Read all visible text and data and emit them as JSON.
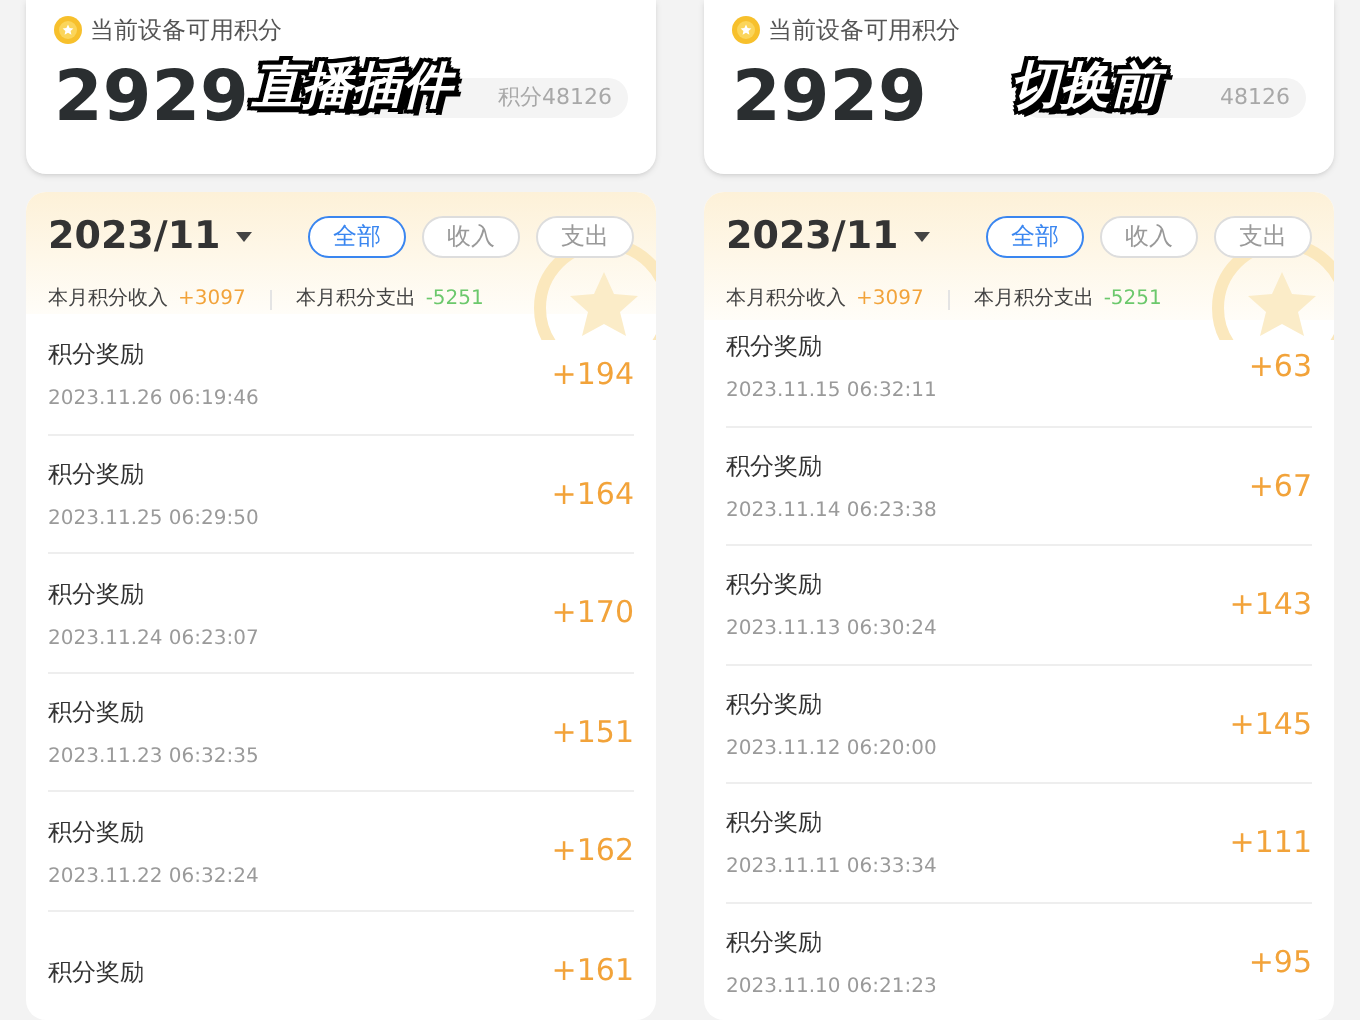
{
  "panels": [
    {
      "overlay": "直播插件",
      "balance_label": "当前设备可用积分",
      "balance": "2929",
      "total_badge": "积分48126",
      "month": "2023/11",
      "filters": [
        {
          "label": "全部",
          "selected": true
        },
        {
          "label": "收入",
          "selected": false
        },
        {
          "label": "支出",
          "selected": false
        }
      ],
      "income_label": "本月积分收入",
      "income": "+3097",
      "expense_label": "本月积分支出",
      "expense": "-5251",
      "records": [
        {
          "title": "积分奖励",
          "date": "2023.11.26 06:19:46",
          "amount": "+194"
        },
        {
          "title": "积分奖励",
          "date": "2023.11.25 06:29:50",
          "amount": "+164"
        },
        {
          "title": "积分奖励",
          "date": "2023.11.24 06:23:07",
          "amount": "+170"
        },
        {
          "title": "积分奖励",
          "date": "2023.11.23 06:32:35",
          "amount": "+151"
        },
        {
          "title": "积分奖励",
          "date": "2023.11.22 06:32:24",
          "amount": "+162"
        },
        {
          "title": "积分奖励",
          "amount": "+161"
        }
      ]
    },
    {
      "overlay": "切换前",
      "balance_label": "当前设备可用积分",
      "balance": "2929",
      "total_badge": "48126",
      "month": "2023/11",
      "filters": [
        {
          "label": "全部",
          "selected": true
        },
        {
          "label": "收入",
          "selected": false
        },
        {
          "label": "支出",
          "selected": false
        }
      ],
      "income_label": "本月积分收入",
      "income": "+3097",
      "expense_label": "本月积分支出",
      "expense": "-5251",
      "records": [
        {
          "title": "积分奖励",
          "date": "2023.11.15 06:32:11",
          "amount": "+63"
        },
        {
          "title": "积分奖励",
          "date": "2023.11.14 06:23:38",
          "amount": "+67"
        },
        {
          "title": "积分奖励",
          "date": "2023.11.13 06:30:24",
          "amount": "+143"
        },
        {
          "title": "积分奖励",
          "date": "2023.11.12 06:20:00",
          "amount": "+145"
        },
        {
          "title": "积分奖励",
          "date": "2023.11.11 06:33:34",
          "amount": "+111"
        },
        {
          "title": "积分奖励",
          "date": "2023.11.10 06:21:23",
          "amount": "+95"
        }
      ]
    }
  ]
}
